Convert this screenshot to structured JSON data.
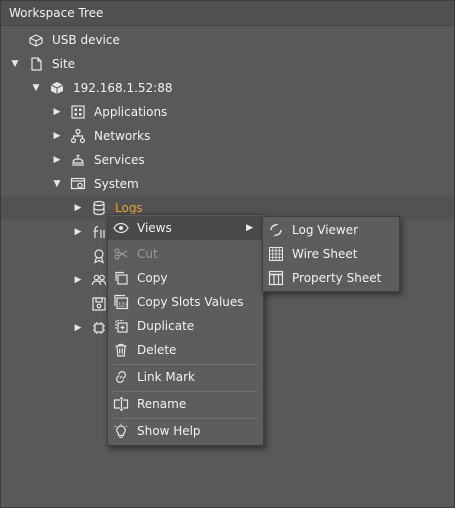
{
  "panel": {
    "title": "Workspace Tree"
  },
  "tree": {
    "usb_device": "USB device",
    "site": "Site",
    "host": "192.168.1.52:88",
    "applications": "Applications",
    "networks": "Networks",
    "services": "Services",
    "system": "System",
    "logs": "Logs"
  },
  "context_menu": {
    "views": "Views",
    "cut": "Cut",
    "copy": "Copy",
    "copy_slots_values": "Copy Slots Values",
    "duplicate": "Duplicate",
    "delete": "Delete",
    "link_mark": "Link Mark",
    "rename": "Rename",
    "show_help": "Show Help"
  },
  "views_submenu": {
    "log_viewer": "Log Viewer",
    "wire_sheet": "Wire Sheet",
    "property_sheet": "Property Sheet"
  },
  "colors": {
    "selected_text": "#e5a03a",
    "background": "#595959",
    "menu": "#5d5d5d"
  }
}
